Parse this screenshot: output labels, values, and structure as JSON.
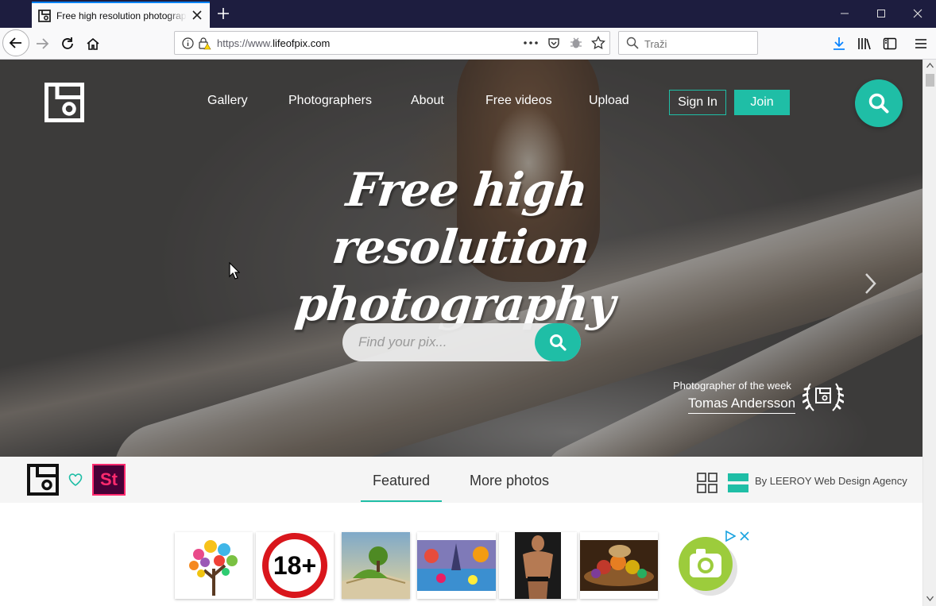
{
  "browser": {
    "tab_title": "Free high resolution photography",
    "url_scheme": "https://www.",
    "url_host": "lifeofpix.com",
    "search_placeholder": "Traži",
    "window_controls": [
      "minimize",
      "maximize",
      "close"
    ]
  },
  "site": {
    "nav": [
      "Gallery",
      "Photographers",
      "About",
      "Free videos",
      "Upload"
    ],
    "sign_in": "Sign In",
    "join": "Join",
    "headline_line1": "Free high resolution",
    "headline_line2": "photography",
    "search_placeholder": "Find your pix...",
    "photographer_of_week_label": "Photographer of the week",
    "photographer_of_week_name": "Tomas Andersson",
    "brand_color": "#1fbea6"
  },
  "subnav": {
    "stock_logo": "St",
    "tabs": [
      "Featured",
      "More photos"
    ],
    "active_tab": "Featured",
    "credit": "By LEEROY Web Design Agency"
  },
  "ads": {
    "items": [
      "colorful-tree",
      "18-plus-sign",
      "open-book-landscape",
      "eiffel-painting",
      "bodybuilder",
      "harvest-food"
    ],
    "badge_text": "18+"
  }
}
